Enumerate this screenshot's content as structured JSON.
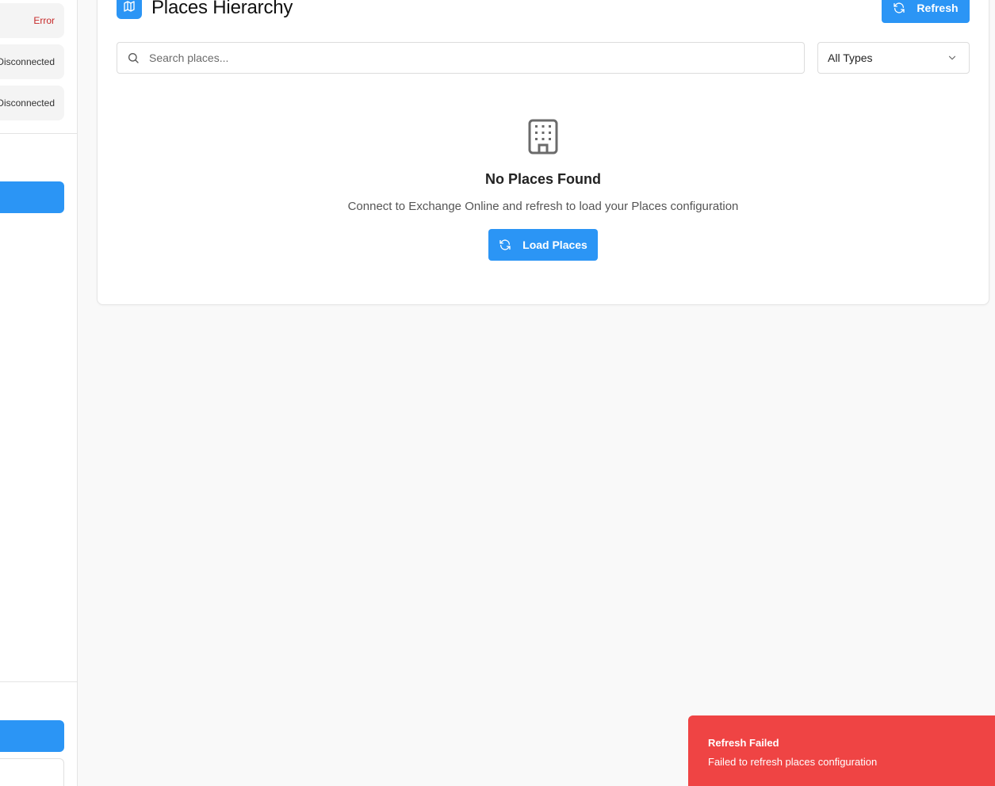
{
  "sidebar": {
    "connections": [
      {
        "status": "Error",
        "status_color": "#c62828"
      },
      {
        "status": "Disconnected"
      },
      {
        "status": "Disconnected"
      }
    ]
  },
  "header": {
    "title": "Places Hierarchy",
    "header_icon": "map-icon",
    "refresh_label": "Refresh",
    "refresh_icon": "refresh-icon"
  },
  "filters": {
    "search_placeholder": "Search places...",
    "search_icon": "search-icon",
    "type_selected": "All Types",
    "type_icon": "chevron-down-icon"
  },
  "empty_state": {
    "icon": "building-icon",
    "title": "No Places Found",
    "description": "Connect to Exchange Online and refresh to load your Places configuration",
    "button_label": "Load Places",
    "button_icon": "refresh-icon"
  },
  "toast": {
    "title": "Refresh Failed",
    "message": "Failed to refresh places configuration",
    "color": "#ef4444"
  },
  "colors": {
    "accent": "#2b95f5",
    "error": "#ef4444"
  }
}
